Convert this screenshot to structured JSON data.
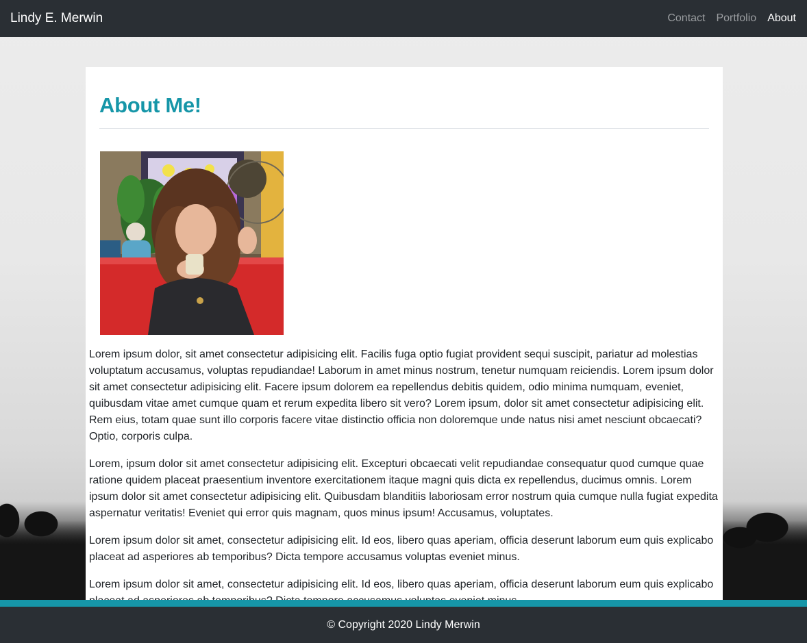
{
  "navbar": {
    "brand": "Lindy E. Merwin",
    "links": [
      {
        "label": "Contact",
        "active": false
      },
      {
        "label": "Portfolio",
        "active": false
      },
      {
        "label": "About",
        "active": true
      }
    ]
  },
  "main": {
    "title": "About Me!",
    "photo_icon": "portrait-photo",
    "paragraphs": [
      "Lorem ipsum dolor, sit amet consectetur adipisicing elit. Facilis fuga optio fugiat provident sequi suscipit, pariatur ad molestias voluptatum accusamus, voluptas repudiandae! Laborum in amet minus nostrum, tenetur numquam reiciendis. Lorem ipsum dolor sit amet consectetur adipisicing elit. Facere ipsum dolorem ea repellendus debitis quidem, odio minima numquam, eveniet, quibusdam vitae amet cumque quam et rerum expedita libero sit vero? Lorem ipsum, dolor sit amet consectetur adipisicing elit. Rem eius, totam quae sunt illo corporis facere vitae distinctio officia non doloremque unde natus nisi amet nesciunt obcaecati? Optio, corporis culpa.",
      "Lorem, ipsum dolor sit amet consectetur adipisicing elit. Excepturi obcaecati velit repudiandae consequatur quod cumque quae ratione quidem placeat praesentium inventore exercitationem itaque magni quis dicta ex repellendus, ducimus omnis. Lorem ipsum dolor sit amet consectetur adipisicing elit. Quibusdam blanditiis laboriosam error nostrum quia cumque nulla fugiat expedita aspernatur veritatis! Eveniet qui error quis magnam, quos minus ipsum! Accusamus, voluptates.",
      "Lorem ipsum dolor sit amet, consectetur adipisicing elit. Id eos, libero quas aperiam, officia deserunt laborum eum quis explicabo placeat ad asperiores ab temporibus? Dicta tempore accusamus voluptas eveniet minus.",
      "Lorem ipsum dolor sit amet, consectetur adipisicing elit. Id eos, libero quas aperiam, officia deserunt laborum eum quis explicabo placeat ad asperiores ab temporibus? Dicta tempore accusamus voluptas eveniet minus."
    ]
  },
  "footer": {
    "text": "© Copyright 2020 Lindy Merwin"
  },
  "colors": {
    "navbar_bg": "#2a2f34",
    "accent": "#1696a8",
    "card_bg": "#ffffff"
  }
}
